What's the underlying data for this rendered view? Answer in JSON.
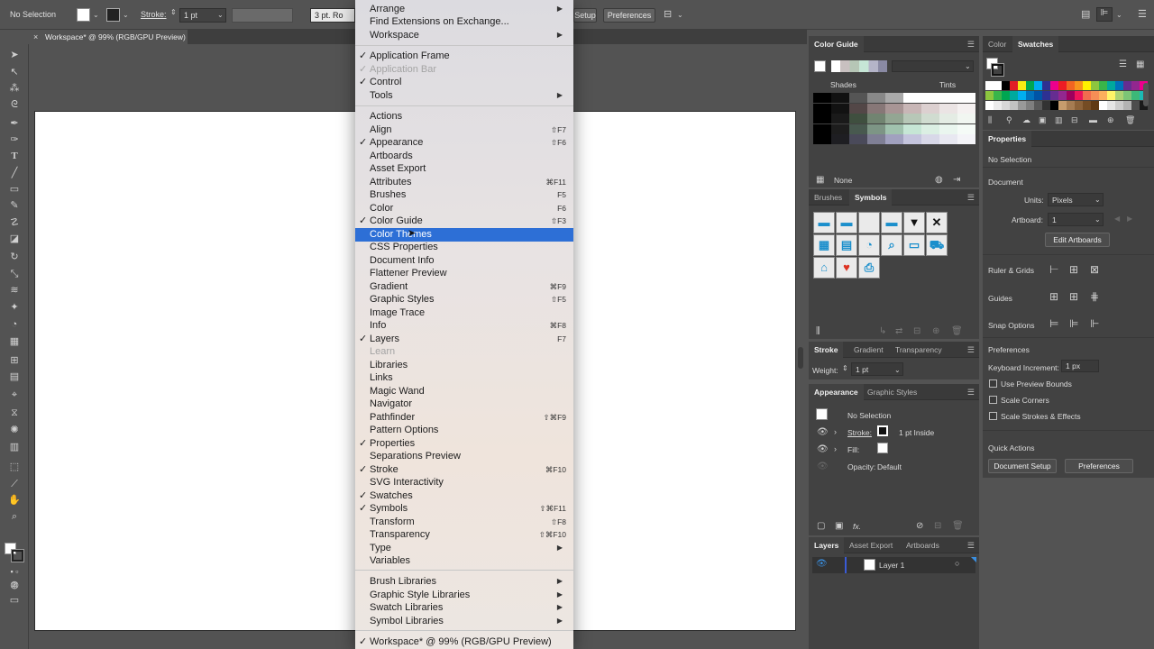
{
  "control_bar": {
    "selection_label": "No Selection",
    "stroke_label": "Stroke:",
    "stroke_value": "1 pt",
    "brush_value": "3 pt. Ro",
    "setup_label": "Setup",
    "preferences_label": "Preferences"
  },
  "document_tab": {
    "close": "×",
    "title": "Workspace* @ 99% (RGB/GPU Preview)"
  },
  "menu": {
    "items": [
      {
        "label": "Arrange",
        "check": "",
        "shortcut": "",
        "sub": "▶"
      },
      {
        "label": "Find Extensions on Exchange...",
        "check": "",
        "shortcut": "",
        "sub": ""
      },
      {
        "label": "Workspace",
        "check": "",
        "shortcut": "",
        "sub": "▶"
      },
      {
        "label": "Application Frame",
        "check": "✓",
        "shortcut": "",
        "sub": ""
      },
      {
        "label": "Application Bar",
        "check": "✓",
        "shortcut": "",
        "sub": ""
      },
      {
        "label": "Control",
        "check": "✓",
        "shortcut": "",
        "sub": ""
      },
      {
        "label": "Tools",
        "check": "",
        "shortcut": "",
        "sub": "▶"
      },
      {
        "label": "Actions",
        "check": "",
        "shortcut": "",
        "sub": ""
      },
      {
        "label": "Align",
        "check": "",
        "shortcut": "⇧F7",
        "sub": ""
      },
      {
        "label": "Appearance",
        "check": "✓",
        "shortcut": "⇧F6",
        "sub": ""
      },
      {
        "label": "Artboards",
        "check": "",
        "shortcut": "",
        "sub": ""
      },
      {
        "label": "Asset Export",
        "check": "",
        "shortcut": "",
        "sub": ""
      },
      {
        "label": "Attributes",
        "check": "",
        "shortcut": "⌘F11",
        "sub": ""
      },
      {
        "label": "Brushes",
        "check": "",
        "shortcut": "F5",
        "sub": ""
      },
      {
        "label": "Color",
        "check": "",
        "shortcut": "F6",
        "sub": ""
      },
      {
        "label": "Color Guide",
        "check": "✓",
        "shortcut": "⇧F3",
        "sub": ""
      },
      {
        "label": "Color Themes",
        "check": "",
        "shortcut": "",
        "sub": ""
      },
      {
        "label": "CSS Properties",
        "check": "",
        "shortcut": "",
        "sub": ""
      },
      {
        "label": "Document Info",
        "check": "",
        "shortcut": "",
        "sub": ""
      },
      {
        "label": "Flattener Preview",
        "check": "",
        "shortcut": "",
        "sub": ""
      },
      {
        "label": "Gradient",
        "check": "",
        "shortcut": "⌘F9",
        "sub": ""
      },
      {
        "label": "Graphic Styles",
        "check": "",
        "shortcut": "⇧F5",
        "sub": ""
      },
      {
        "label": "Image Trace",
        "check": "",
        "shortcut": "",
        "sub": ""
      },
      {
        "label": "Info",
        "check": "",
        "shortcut": "⌘F8",
        "sub": ""
      },
      {
        "label": "Layers",
        "check": "✓",
        "shortcut": "F7",
        "sub": ""
      },
      {
        "label": "Learn",
        "check": "",
        "shortcut": "",
        "sub": ""
      },
      {
        "label": "Libraries",
        "check": "",
        "shortcut": "",
        "sub": ""
      },
      {
        "label": "Links",
        "check": "",
        "shortcut": "",
        "sub": ""
      },
      {
        "label": "Magic Wand",
        "check": "",
        "shortcut": "",
        "sub": ""
      },
      {
        "label": "Navigator",
        "check": "",
        "shortcut": "",
        "sub": ""
      },
      {
        "label": "Pathfinder",
        "check": "",
        "shortcut": "⇧⌘F9",
        "sub": ""
      },
      {
        "label": "Pattern Options",
        "check": "",
        "shortcut": "",
        "sub": ""
      },
      {
        "label": "Properties",
        "check": "✓",
        "shortcut": "",
        "sub": ""
      },
      {
        "label": "Separations Preview",
        "check": "",
        "shortcut": "",
        "sub": ""
      },
      {
        "label": "Stroke",
        "check": "✓",
        "shortcut": "⌘F10",
        "sub": ""
      },
      {
        "label": "SVG Interactivity",
        "check": "",
        "shortcut": "",
        "sub": ""
      },
      {
        "label": "Swatches",
        "check": "✓",
        "shortcut": "",
        "sub": ""
      },
      {
        "label": "Symbols",
        "check": "✓",
        "shortcut": "⇧⌘F11",
        "sub": ""
      },
      {
        "label": "Transform",
        "check": "",
        "shortcut": "⇧F8",
        "sub": ""
      },
      {
        "label": "Transparency",
        "check": "",
        "shortcut": "⇧⌘F10",
        "sub": ""
      },
      {
        "label": "Type",
        "check": "",
        "shortcut": "",
        "sub": "▶"
      },
      {
        "label": "Variables",
        "check": "",
        "shortcut": "",
        "sub": ""
      },
      {
        "label": "Brush Libraries",
        "check": "",
        "shortcut": "",
        "sub": "▶"
      },
      {
        "label": "Graphic Style Libraries",
        "check": "",
        "shortcut": "",
        "sub": "▶"
      },
      {
        "label": "Swatch Libraries",
        "check": "",
        "shortcut": "",
        "sub": "▶"
      },
      {
        "label": "Symbol Libraries",
        "check": "",
        "shortcut": "",
        "sub": "▶"
      },
      {
        "label": "Workspace* @ 99% (RGB/GPU Preview)",
        "check": "✓",
        "shortcut": "",
        "sub": ""
      }
    ]
  },
  "color_guide": {
    "tab": "Color Guide",
    "shades": "Shades",
    "tints": "Tints",
    "none_label": "None"
  },
  "symbols_panel": {
    "tab_brushes": "Brushes",
    "tab_symbols": "Symbols"
  },
  "stroke_panel": {
    "tab_stroke": "Stroke",
    "tab_gradient": "Gradient",
    "tab_transparency": "Transparency",
    "weight_label": "Weight:",
    "weight_value": "1 pt"
  },
  "appearance_panel": {
    "tab_appearance": "Appearance",
    "tab_graphic_styles": "Graphic Styles",
    "no_selection": "No Selection",
    "stroke_label": "Stroke:",
    "stroke_value": "1 pt  Inside",
    "fill_label": "Fill:",
    "opacity_label": "Opacity:",
    "opacity_value": "Default",
    "fx": "fx."
  },
  "layers_panel": {
    "tab_layers": "Layers",
    "tab_asset_export": "Asset Export",
    "tab_artboards": "Artboards",
    "layer_name": "Layer 1"
  },
  "swatches_panel": {
    "tab_color": "Color",
    "tab_swatches": "Swatches"
  },
  "properties_panel": {
    "tab": "Properties",
    "no_selection": "No Selection",
    "document": "Document",
    "units_label": "Units:",
    "units_value": "Pixels",
    "artboard_label": "Artboard:",
    "artboard_value": "1",
    "edit_artboards": "Edit Artboards",
    "ruler_grids": "Ruler & Grids",
    "guides": "Guides",
    "snap_options": "Snap Options",
    "preferences": "Preferences",
    "keyboard_increment_label": "Keyboard Increment:",
    "keyboard_increment_value": "1 px",
    "use_preview_bounds": "Use Preview Bounds",
    "scale_corners": "Scale Corners",
    "scale_strokes": "Scale Strokes & Effects",
    "quick_actions": "Quick Actions",
    "document_setup": "Document Setup",
    "preferences_button": "Preferences"
  }
}
